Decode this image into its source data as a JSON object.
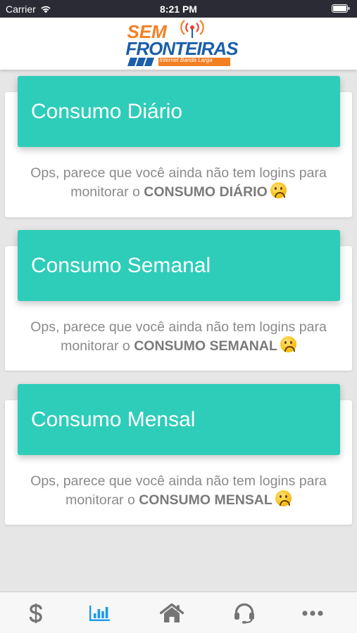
{
  "status_bar": {
    "carrier": "Carrier",
    "time": "8:21 PM"
  },
  "header": {
    "logo": {
      "line1": "SEM",
      "line2": "FRONTEIRAS",
      "line3": "Internet Banda Larga"
    }
  },
  "cards": [
    {
      "title": "Consumo Diário",
      "message": "Ops, parece que você ainda não tem logins para",
      "prefix": "monitorar o",
      "emphasis": "CONSUMO DIÁRIO"
    },
    {
      "title": "Consumo Semanal",
      "message": "Ops, parece que você ainda não tem logins para",
      "prefix": "monitorar o",
      "emphasis": "CONSUMO SEMANAL"
    },
    {
      "title": "Consumo Mensal",
      "message": "Ops, parece que você ainda não tem logins para",
      "prefix": "monitorar o",
      "emphasis": "CONSUMO MENSAL"
    }
  ],
  "tabbar": {
    "items": [
      {
        "icon": "dollar-icon",
        "active": false
      },
      {
        "icon": "bar-chart-icon",
        "active": true
      },
      {
        "icon": "home-icon",
        "active": false
      },
      {
        "icon": "headset-icon",
        "active": false
      },
      {
        "icon": "more-icon",
        "active": false
      }
    ],
    "active_color": "#1a9be8",
    "inactive_color": "#757575"
  },
  "colors": {
    "card_header": "#2ecdb9",
    "background": "#e6e6e6",
    "brand_orange": "#f37f23",
    "brand_blue": "#1b5fa8"
  }
}
